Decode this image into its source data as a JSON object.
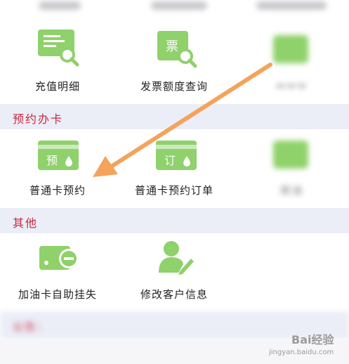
{
  "colors": {
    "accent_red": "#c8283c",
    "icon_green": "#8fd16a",
    "arrow_orange": "#f5a25a",
    "section_bg": "#ebeef7"
  },
  "query": {
    "items": [
      {
        "label": "充值明细",
        "icon": "recharge-detail-icon"
      },
      {
        "label": "发票额度查询",
        "icon": "invoice-query-icon"
      },
      {
        "label": "",
        "icon": "blurred-green-icon"
      }
    ]
  },
  "booking": {
    "title": "预约办卡",
    "items": [
      {
        "label": "普通卡预约",
        "icon": "card-booking-icon",
        "icon_text": "预"
      },
      {
        "label": "普通卡预约订单",
        "icon": "card-order-icon",
        "icon_text": "订"
      },
      {
        "label": "柴油",
        "icon": "blurred-green-icon"
      }
    ]
  },
  "other": {
    "title": "其他",
    "items": [
      {
        "label": "加油卡自助挂失",
        "icon": "card-report-loss-icon"
      },
      {
        "label": "修改客户信息",
        "icon": "edit-user-icon"
      }
    ]
  },
  "notice": {
    "title": "公告："
  },
  "watermark": {
    "brand": "Bai经验",
    "url": "jingyan.baidu.com"
  }
}
